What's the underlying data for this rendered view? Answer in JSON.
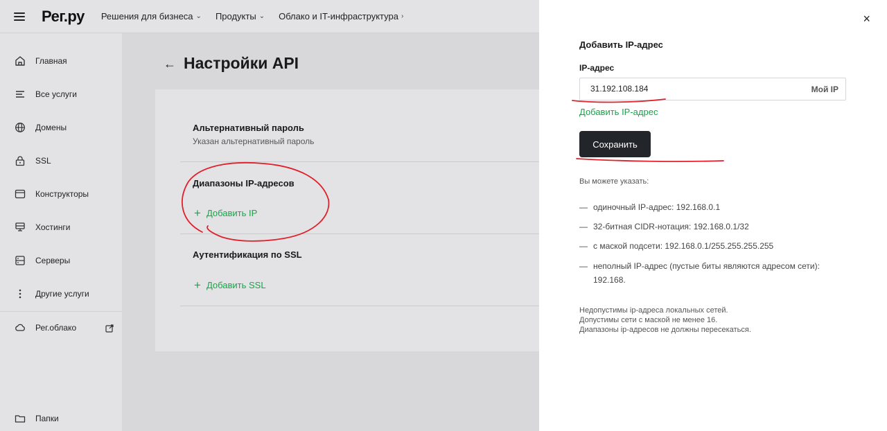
{
  "header": {
    "logo": "Рег.ру",
    "nav": [
      {
        "label": "Решения для бизнеса",
        "chevron": "⌄"
      },
      {
        "label": "Продукты",
        "chevron": "⌄"
      },
      {
        "label": "Облако и IT-инфраструктура",
        "chevron": "›"
      }
    ]
  },
  "sidebar": {
    "items": [
      {
        "label": "Главная",
        "icon": "home-icon"
      },
      {
        "label": "Все услуги",
        "icon": "list-icon"
      },
      {
        "label": "Домены",
        "icon": "globe-icon"
      },
      {
        "label": "SSL",
        "icon": "lock-icon"
      },
      {
        "label": "Конструкторы",
        "icon": "browser-icon"
      },
      {
        "label": "Хостинги",
        "icon": "hosting-icon"
      },
      {
        "label": "Серверы",
        "icon": "server-icon"
      },
      {
        "label": "Другие услуги",
        "icon": "more-vertical-icon"
      },
      {
        "label": "Рег.облако",
        "icon": "cloud-icon"
      },
      {
        "label": "Папки",
        "icon": "folder-icon"
      }
    ]
  },
  "main": {
    "title": "Настройки API",
    "sections": {
      "alt_password_title": "Альтернативный пароль",
      "alt_password_sub": "Указан альтернативный пароль",
      "ip_ranges_title": "Диапазоны IP-адресов",
      "add_ip": "Добавить IP",
      "ssl_auth_title": "Аутентификация по SSL",
      "add_ssl": "Добавить SSL"
    }
  },
  "drawer": {
    "close": "×",
    "title": "Добавить IP-адрес",
    "ip_label": "IP-адрес",
    "ip_value": "31.192.108.184",
    "my_ip": "Мой IP",
    "add_ip_link": "Добавить IP-адрес",
    "save": "Сохранить",
    "hint_title": "Вы можете указать:",
    "hints": [
      "одиночный IP-адрес: 192.168.0.1",
      "32-битная CIDR-нотация: 192.168.0.1/32",
      "с маской подсети: 192.168.0.1/255.255.255.255",
      "неполный IP-адрес (пустые биты являются адресом сети): 192.168."
    ],
    "notes": [
      "Недопустимы ip-адреса локальных сетей.",
      "Допустимы сети с маской не менее 16.",
      "Диапазоны ip-адресов не должны пересекаться."
    ]
  },
  "colors": {
    "accent_green": "#1aa34a",
    "button_dark": "#22262b",
    "annotation_red": "#e0202a"
  }
}
